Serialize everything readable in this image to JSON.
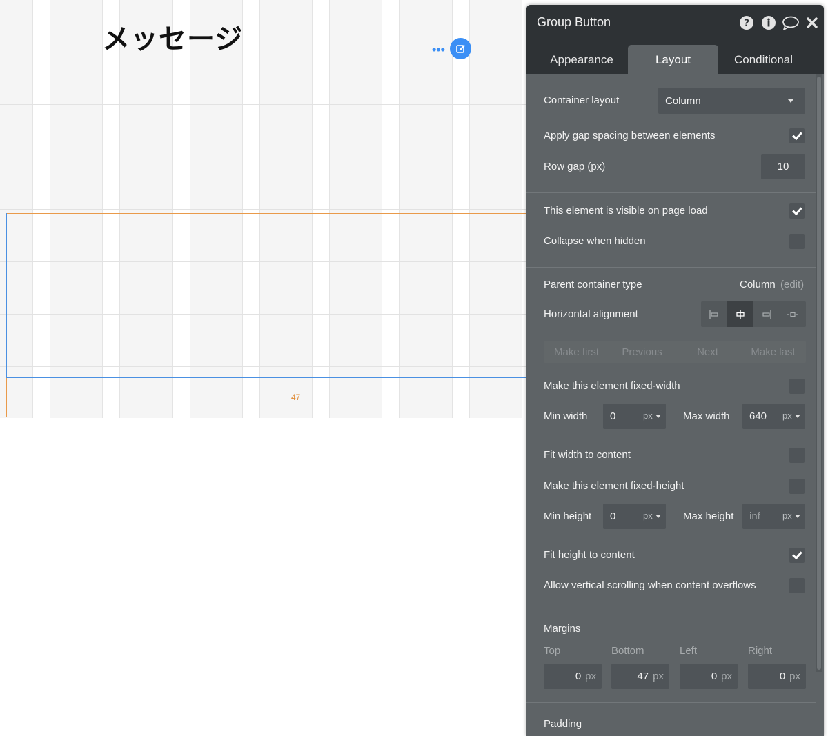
{
  "canvas": {
    "heading": "メッセージ",
    "margin_indicator": "47"
  },
  "panel": {
    "title": "Group Button",
    "header_icons": [
      "help-icon",
      "info-icon",
      "comment-icon",
      "close-icon"
    ],
    "tabs": [
      {
        "label": "Appearance",
        "active": false
      },
      {
        "label": "Layout",
        "active": true
      },
      {
        "label": "Conditional",
        "active": false
      }
    ],
    "container_layout": {
      "label": "Container layout",
      "value": "Column"
    },
    "gap_spacing": {
      "label": "Apply gap spacing between elements",
      "checked": true
    },
    "row_gap": {
      "label": "Row gap (px)",
      "value": "10"
    },
    "visible_on_load": {
      "label": "This element is visible on page load",
      "checked": true
    },
    "collapse_hidden": {
      "label": "Collapse when hidden",
      "checked": false
    },
    "parent_container": {
      "label": "Parent container type",
      "value": "Column",
      "edit": "(edit)"
    },
    "horizontal_alignment": {
      "label": "Horizontal alignment",
      "options": [
        "left",
        "center",
        "right",
        "stretch"
      ],
      "selected": "center"
    },
    "ordering": [
      "Make first",
      "Previous",
      "Next",
      "Make last"
    ],
    "fixed_width": {
      "label": "Make this element fixed-width",
      "checked": false
    },
    "min_width": {
      "label": "Min width",
      "value": "0",
      "unit": "px"
    },
    "max_width": {
      "label": "Max width",
      "value": "640",
      "unit": "px"
    },
    "fit_width": {
      "label": "Fit width to content",
      "checked": false
    },
    "fixed_height": {
      "label": "Make this element fixed-height",
      "checked": false
    },
    "min_height": {
      "label": "Min height",
      "value": "0",
      "unit": "px"
    },
    "max_height": {
      "label": "Max height",
      "placeholder": "inf",
      "unit": "px"
    },
    "fit_height": {
      "label": "Fit height to content",
      "checked": true
    },
    "vertical_scroll": {
      "label": "Allow vertical scrolling when content overflows",
      "checked": false
    },
    "margins": {
      "title": "Margins",
      "fields": [
        {
          "label": "Top",
          "value": "0",
          "unit": "px"
        },
        {
          "label": "Bottom",
          "value": "47",
          "unit": "px"
        },
        {
          "label": "Left",
          "value": "0",
          "unit": "px"
        },
        {
          "label": "Right",
          "value": "0",
          "unit": "px"
        }
      ]
    },
    "padding_title": "Padding"
  },
  "colors": {
    "accent": "#3b8ff5",
    "panel_bg": "#5e6366",
    "panel_header": "#2e3235",
    "selection_orange": "#e99a4a",
    "selection_blue": "#4a90e2"
  }
}
